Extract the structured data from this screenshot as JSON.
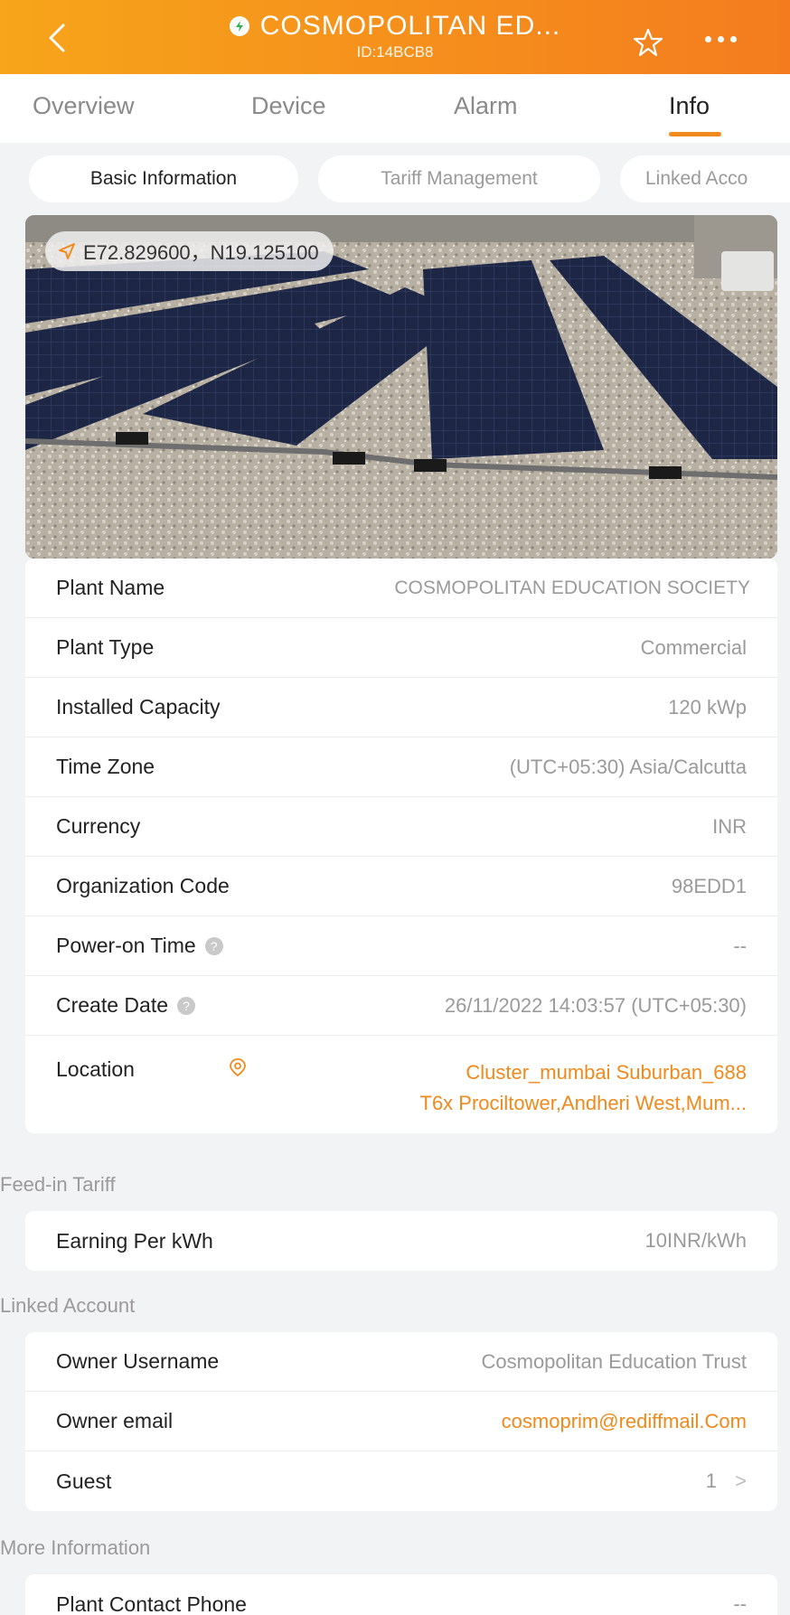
{
  "header": {
    "title": "COSMOPOLITAN ED...",
    "subtitle": "ID:14BCB8",
    "brand_color": "#f47c1e",
    "icons": [
      "back-arrow-icon",
      "online-status-icon",
      "star-icon",
      "more-dots-icon"
    ]
  },
  "tabs": [
    {
      "label": "Overview"
    },
    {
      "label": "Device"
    },
    {
      "label": "Alarm"
    },
    {
      "label": "Info",
      "active": true
    }
  ],
  "subtabs": [
    {
      "label": "Basic Information",
      "active": true
    },
    {
      "label": "Tariff Management"
    },
    {
      "label": "Linked Acco"
    }
  ],
  "photo": {
    "coordinates": "E72.829600，N19.125100"
  },
  "basic": {
    "plant_name": {
      "label": "Plant Name",
      "value": "COSMOPOLITAN EDUCATION SOCIETY"
    },
    "plant_type": {
      "label": "Plant Type",
      "value": "Commercial"
    },
    "installed_capacity": {
      "label": "Installed Capacity",
      "value": "120 kWp"
    },
    "time_zone": {
      "label": "Time Zone",
      "value": "(UTC+05:30) Asia/Calcutta"
    },
    "currency": {
      "label": "Currency",
      "value": "INR"
    },
    "org_code": {
      "label": "Organization Code",
      "value": "98EDD1"
    },
    "power_on": {
      "label": "Power-on Time",
      "value": "--"
    },
    "create_date": {
      "label": "Create Date",
      "value": "26/11/2022 14:03:57 (UTC+05:30)"
    },
    "location": {
      "label": "Location",
      "line1": "Cluster_mumbai Suburban_688",
      "line2": "T6x Prociltower,Andheri West,Mum..."
    }
  },
  "feed_in": {
    "title": "Feed-in Tariff",
    "earning": {
      "label": "Earning Per kWh",
      "value": "10INR/kWh"
    }
  },
  "linked": {
    "title": "Linked Account",
    "owner_username": {
      "label": "Owner Username",
      "value": "Cosmopolitan Education Trust"
    },
    "owner_email": {
      "label": "Owner email",
      "value": "cosmoprim@rediffmail.Com"
    },
    "guest": {
      "label": "Guest",
      "value": "1"
    }
  },
  "more": {
    "title": "More Information",
    "contact_phone": {
      "label": "Plant Contact Phone",
      "value": "--"
    }
  }
}
